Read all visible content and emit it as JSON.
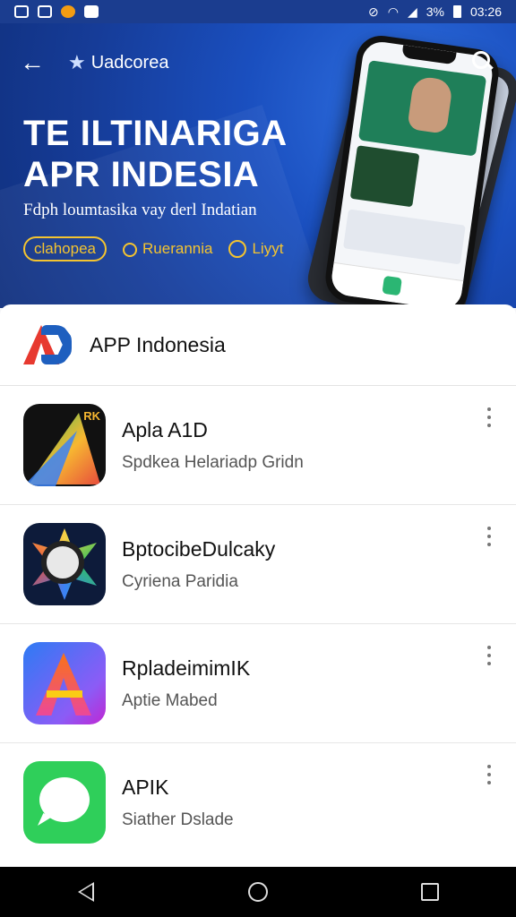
{
  "status_bar": {
    "battery": "3%",
    "time": "03:26"
  },
  "hero": {
    "title": "Uadcorea",
    "headline_line1": "TE ILTINARIGA",
    "headline_line2": "APR INDESIA",
    "subtitle": "Fdph loumtasika vay derl Indatian",
    "tags": [
      "clahopea",
      "Ruerannia",
      "Liyyt"
    ]
  },
  "section": {
    "title": "APP Indonesia"
  },
  "apps": [
    {
      "name": "Apla A1D",
      "subtitle": "Spdkea Helariadp Gridn"
    },
    {
      "name": "BptocibeDulcaky",
      "subtitle": "Cyriena Paridia"
    },
    {
      "name": "RpladeimimIK",
      "subtitle": "Aptie Mabed"
    },
    {
      "name": "APIK",
      "subtitle": "Siather Dslade"
    }
  ]
}
